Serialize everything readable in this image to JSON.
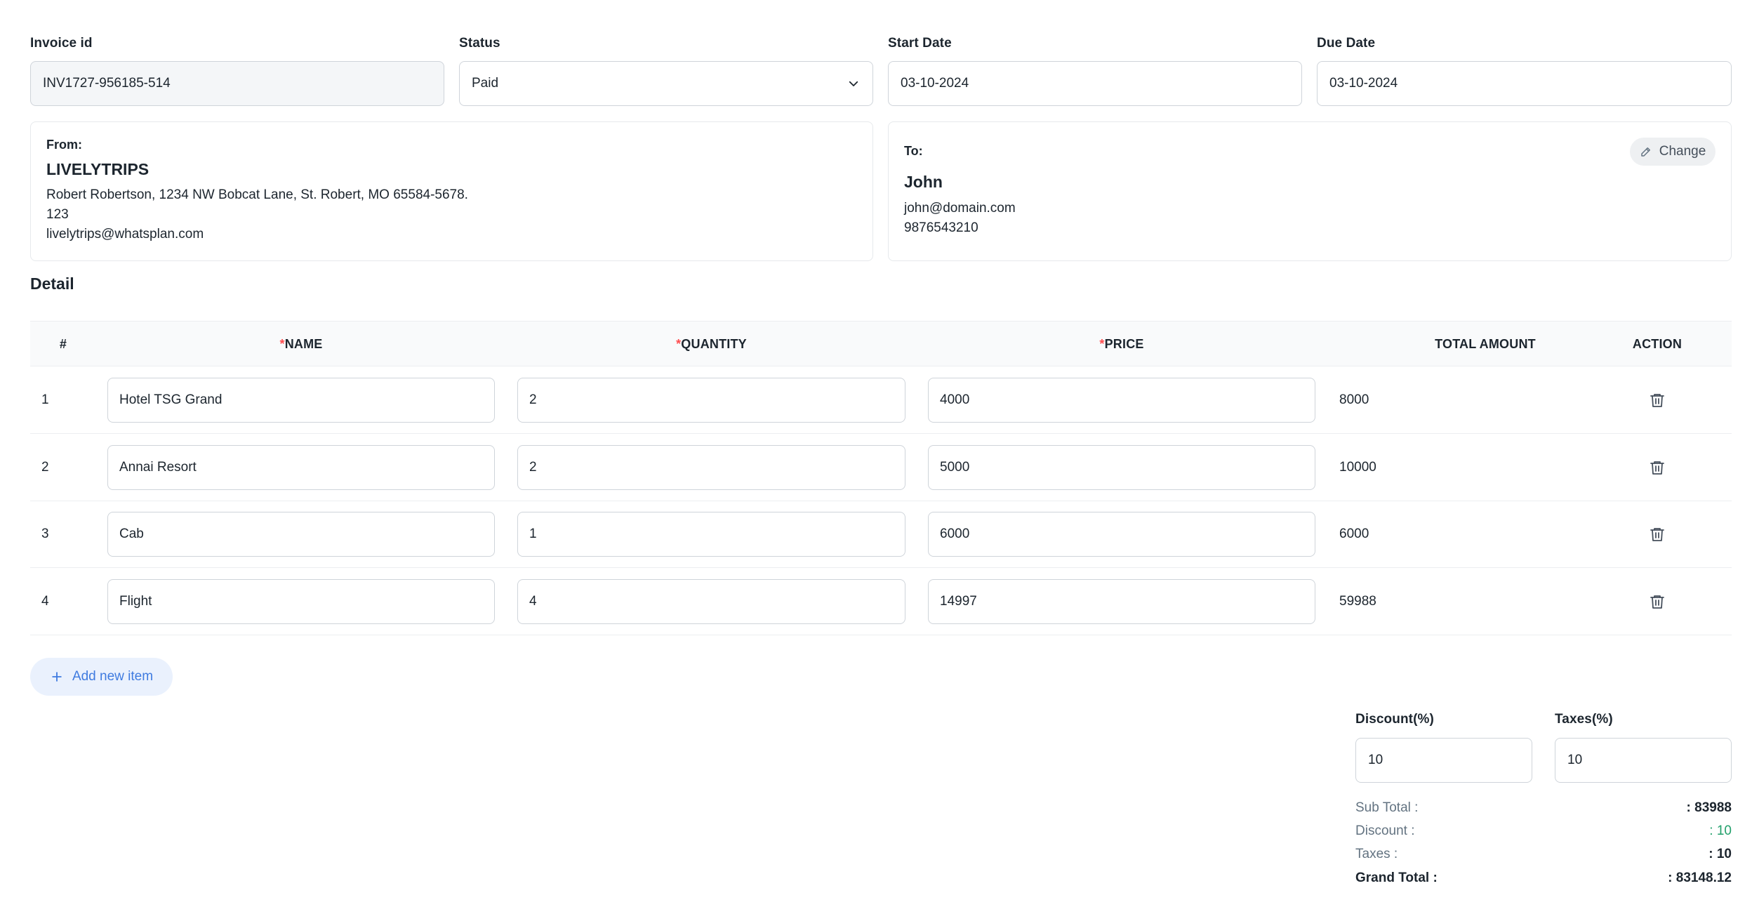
{
  "header": {
    "invoice_id": {
      "label": "Invoice id",
      "value": "INV1727-956185-514"
    },
    "status": {
      "label": "Status",
      "value": "Paid"
    },
    "start_date": {
      "label": "Start Date",
      "value": "03-10-2024"
    },
    "due_date": {
      "label": "Due Date",
      "value": "03-10-2024"
    }
  },
  "from": {
    "label": "From:",
    "name": "LIVELYTRIPS",
    "address": "Robert Robertson, 1234 NW Bobcat Lane, St. Robert, MO 65584-5678.",
    "line2": "123",
    "email": "livelytrips@whatsplan.com"
  },
  "to": {
    "label": "To:",
    "name": "John",
    "email": "john@domain.com",
    "phone": "9876543210",
    "change_label": "Change"
  },
  "detail": {
    "title": "Detail",
    "columns": {
      "index": "#",
      "required_mark": "*",
      "name": "NAME",
      "quantity": "QUANTITY",
      "price": "PRICE",
      "total": "TOTAL AMOUNT",
      "action": "ACTION"
    },
    "rows": [
      {
        "num": "1",
        "name": "Hotel TSG Grand",
        "quantity": "2",
        "price": "4000",
        "total": "8000"
      },
      {
        "num": "2",
        "name": "Annai Resort",
        "quantity": "2",
        "price": "5000",
        "total": "10000"
      },
      {
        "num": "3",
        "name": "Cab",
        "quantity": "1",
        "price": "6000",
        "total": "6000"
      },
      {
        "num": "4",
        "name": "Flight",
        "quantity": "4",
        "price": "14997",
        "total": "59988"
      }
    ],
    "add_item_label": "Add new item"
  },
  "summary": {
    "discount": {
      "label": "Discount(%)",
      "value": "10"
    },
    "taxes": {
      "label": "Taxes(%)",
      "value": "10"
    },
    "sub_total": {
      "label": "Sub Total :",
      "value": ": 83988"
    },
    "discount_row": {
      "label": "Discount :",
      "value": ": 10"
    },
    "taxes_row": {
      "label": "Taxes :",
      "value": ": 10"
    },
    "grand_total": {
      "label": "Grand Total :",
      "value": ": 83148.12"
    }
  },
  "icons": {
    "status_dropdown": "chevron-down-icon",
    "change": "pencil-icon",
    "delete": "trash-icon",
    "add": "plus-icon"
  },
  "colors": {
    "accent": "#3f7be0",
    "required": "#ff4d4f",
    "discount_value": "#22a06b"
  }
}
